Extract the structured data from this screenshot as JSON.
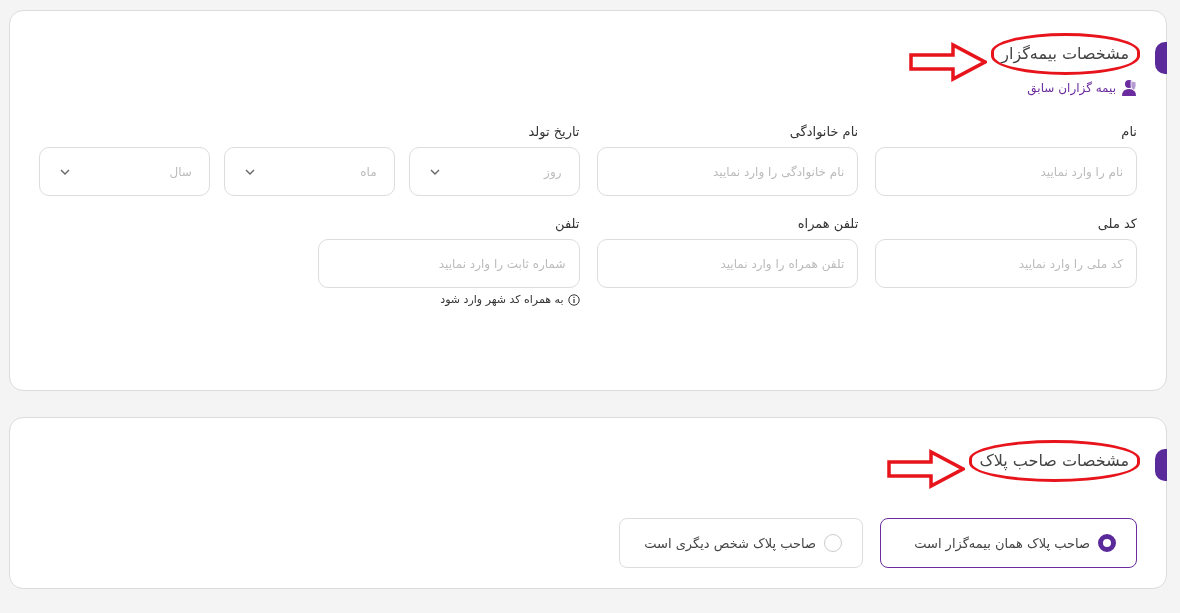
{
  "sections": [
    {
      "title": "مشخصات بیمه‌گزار",
      "highlighted": true,
      "link": "بیمه گزاران سابق",
      "fields": [
        {
          "kind": "text",
          "label": "نام",
          "placeholder": "نام را وارد نمایید"
        },
        {
          "kind": "text",
          "label": "نام خانوادگی",
          "placeholder": "نام خانوادگی را وارد نمایید"
        },
        {
          "kind": "date",
          "label": "تاریخ تولد",
          "selects": [
            {
              "placeholder": "روز"
            },
            {
              "placeholder": "ماه"
            },
            {
              "placeholder": "سال"
            }
          ]
        },
        {
          "kind": "text",
          "label": "کد ملی",
          "placeholder": "کد ملی را وارد نمایید"
        },
        {
          "kind": "text",
          "label": "تلفن همراه",
          "placeholder": "تلفن همراه را وارد نمایید"
        },
        {
          "kind": "text",
          "label": "تلفن",
          "placeholder": "شماره ثابت را وارد نمایید",
          "hint": "به همراه کد شهر وارد شود"
        }
      ]
    },
    {
      "title": "مشخصات صاحب پلاک",
      "highlighted": true,
      "options": [
        {
          "label": "صاحب پلاک همان بیمه‌گزار است",
          "selected": true
        },
        {
          "label": "صاحب پلاک شخص دیگری است",
          "selected": false
        }
      ]
    }
  ]
}
